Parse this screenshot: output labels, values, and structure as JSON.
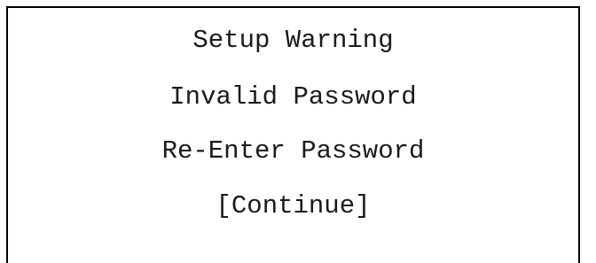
{
  "dialog": {
    "title": "Setup Warning",
    "message": "Invalid Password",
    "instruction": "Re-Enter Password",
    "continue_label": "[Continue]"
  },
  "colors": {
    "background": "#ffffff",
    "border": "#000000",
    "text": "#1a1a1a"
  }
}
